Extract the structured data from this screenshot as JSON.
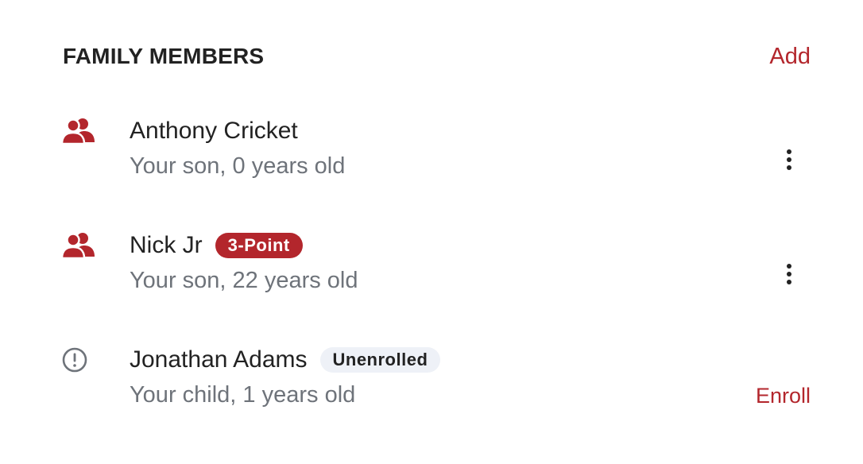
{
  "section": {
    "title": "FAMILY MEMBERS",
    "add_label": "Add"
  },
  "members": [
    {
      "name": "Anthony Cricket",
      "subtitle": "Your son, 0 years old",
      "icon": "people-icon",
      "badge": "",
      "action": "more-options"
    },
    {
      "name": "Nick Jr",
      "subtitle": "Your son, 22 years old",
      "icon": "people-icon",
      "badge": "3-Point",
      "action": "more-options"
    },
    {
      "name": "Jonathan Adams",
      "subtitle": "Your child, 1 years old",
      "icon": "alert-circle-icon",
      "badge": "Unenrolled",
      "action_label": "Enroll"
    }
  ],
  "colors": {
    "accent": "#b3262c",
    "text": "#222222",
    "muted_text": "#6e737a",
    "neutral_badge_bg": "#eef1f7"
  }
}
